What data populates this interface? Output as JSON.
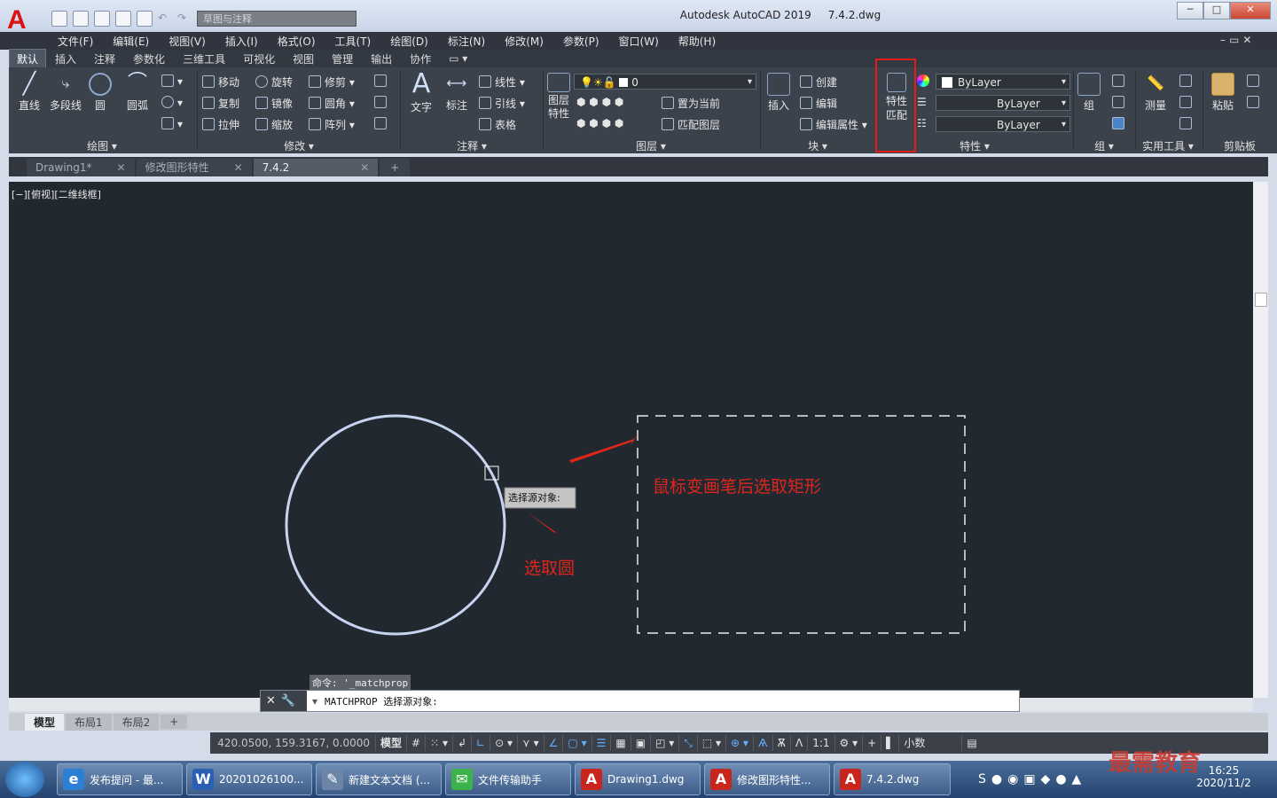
{
  "title": {
    "app": "Autodesk AutoCAD 2019",
    "file": "7.4.2.dwg",
    "workspace_dropdown": "草图与注释"
  },
  "menu": [
    "文件(F)",
    "编辑(E)",
    "视图(V)",
    "插入(I)",
    "格式(O)",
    "工具(T)",
    "绘图(D)",
    "标注(N)",
    "修改(M)",
    "参数(P)",
    "窗口(W)",
    "帮助(H)"
  ],
  "ribbon_tabs": [
    "默认",
    "插入",
    "注释",
    "参数化",
    "三维工具",
    "可视化",
    "视图",
    "管理",
    "输出",
    "协作"
  ],
  "ribbon": {
    "draw": {
      "line": "直线",
      "polyline": "多段线",
      "circle": "圆",
      "arc": "圆弧",
      "panel": "绘图 ▾"
    },
    "modify": {
      "move": "移动",
      "rotate": "旋转",
      "trim": "修剪",
      "copy": "复制",
      "mirror": "镜像",
      "fillet": "圆角",
      "stretch": "拉伸",
      "scale": "缩放",
      "array": "阵列",
      "panel": "修改 ▾"
    },
    "annotation": {
      "text": "文字",
      "dimension": "标注",
      "linear": "线性",
      "leader": "引线",
      "table": "表格",
      "panel": "注释 ▾"
    },
    "layers": {
      "layer_props": "图层\n特性",
      "layer_value": "0",
      "make_current": "置为当前",
      "match_layer": "匹配图层",
      "panel": "图层 ▾"
    },
    "block": {
      "insert": "插入",
      "create": "创建",
      "edit": "编辑",
      "edit_attr": "编辑属性",
      "panel": "块 ▾"
    },
    "matchprop": {
      "label1": "特性",
      "label2": "匹配"
    },
    "properties": {
      "color": "ByLayer",
      "linetype": "ByLayer",
      "lineweight": "ByLayer",
      "panel": "特性 ▾"
    },
    "groups": {
      "group": "组",
      "panel": "组 ▾"
    },
    "utilities": {
      "measure": "测量",
      "panel": "实用工具 ▾"
    },
    "clipboard": {
      "paste": "粘贴",
      "panel": "剪贴板"
    }
  },
  "doc_tabs": [
    "Drawing1*",
    "修改图形特性",
    "7.4.2"
  ],
  "viewport_label": "[−][俯视][二维线框]",
  "tooltip": "选择源对象:",
  "annotations": {
    "rect": "鼠标变画笔后选取矩形",
    "circle": "选取圆"
  },
  "command": {
    "history": "命令: '_matchprop",
    "prompt": "MATCHPROP 选择源对象:"
  },
  "layout_tabs": [
    "模型",
    "布局1",
    "布局2"
  ],
  "status": {
    "coords": "420.0500, 159.3167, 0.0000",
    "model": "模型",
    "scale": "1:1",
    "units": "小数"
  },
  "taskbar": [
    {
      "label": "发布提问 - 最...",
      "icon": "ie-icon",
      "color": "#2d7fd3"
    },
    {
      "label": "20201026100...",
      "icon": "word-icon",
      "color": "#2b5fb4"
    },
    {
      "label": "新建文本文档 (...",
      "icon": "notepad-icon",
      "color": "#6d86a8"
    },
    {
      "label": "文件传输助手",
      "icon": "wechat-icon",
      "color": "#3bb34a"
    },
    {
      "label": "Drawing1.dwg",
      "icon": "autocad-icon",
      "color": "#c8261c"
    },
    {
      "label": "修改图形特性...",
      "icon": "autocad-icon",
      "color": "#c8261c"
    },
    {
      "label": "7.4.2.dwg",
      "icon": "autocad-icon",
      "color": "#c8261c"
    }
  ],
  "clock": {
    "time": "16:25",
    "date": "2020/11/2"
  },
  "watermark": "最需教育"
}
